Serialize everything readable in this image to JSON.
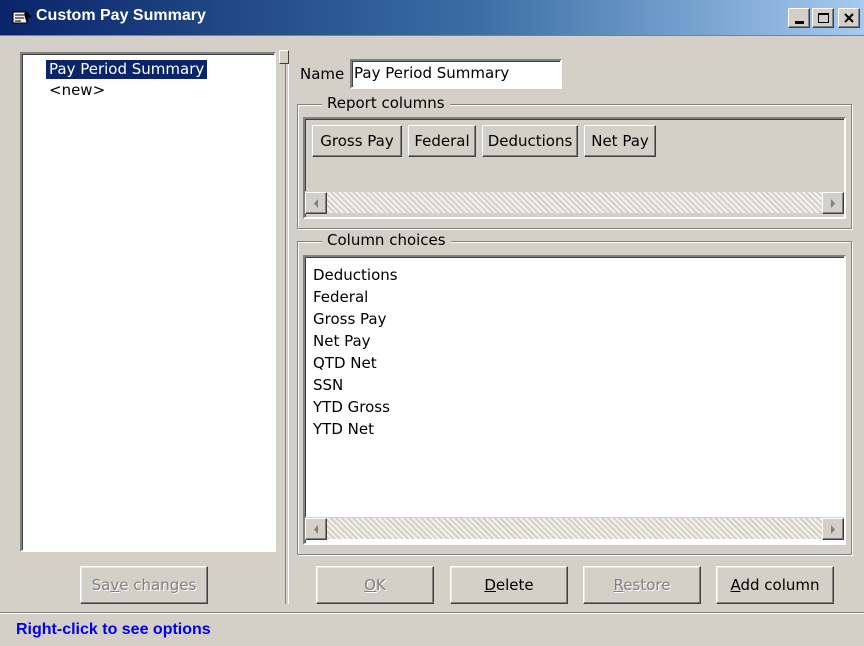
{
  "window": {
    "title": "Custom Pay Summary",
    "controls": {
      "minimize": "_",
      "maximize": "□",
      "close": "✕"
    }
  },
  "summaries": {
    "items": [
      {
        "label": "Pay Period Summary",
        "selected": true
      },
      {
        "label": "<new>",
        "selected": false
      }
    ],
    "save_button": {
      "pre": "Sa",
      "key": "v",
      "post": "e changes",
      "enabled": false
    }
  },
  "name": {
    "label": "Name",
    "value": "Pay Period Summary"
  },
  "report_columns": {
    "label": "Report columns",
    "items": [
      "Gross Pay",
      "Federal",
      "Deductions",
      "Net Pay"
    ]
  },
  "column_choices": {
    "label": "Column choices",
    "items": [
      "Deductions",
      "Federal",
      "Gross Pay",
      "Net Pay",
      "QTD Net",
      "SSN",
      "YTD Gross",
      "YTD Net"
    ]
  },
  "buttons": {
    "ok": {
      "key": "O",
      "post": "K",
      "enabled": false
    },
    "delete": {
      "key": "D",
      "post": "elete",
      "enabled": true
    },
    "restore": {
      "key": "R",
      "post": "estore",
      "enabled": false
    },
    "add_column": {
      "key": "A",
      "post": "dd column",
      "enabled": true
    }
  },
  "status_bar": {
    "text": "Right-click to see options",
    "color": "#0000ee"
  },
  "colors": {
    "face": "#d4d0c8",
    "title_start": "#0a246a",
    "title_end": "#a6caf0",
    "selection": "#0a246a"
  }
}
